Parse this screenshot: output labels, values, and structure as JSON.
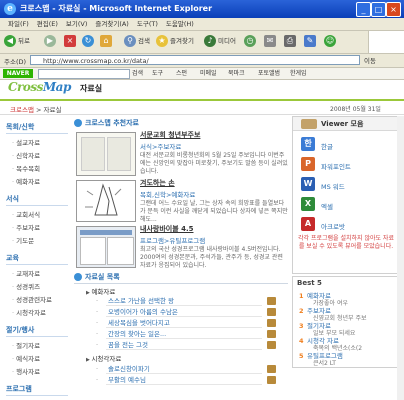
{
  "window": {
    "title": "크로스맵 - 자료실 - Microsoft Internet Explorer",
    "minimize": "_",
    "maximize": "□",
    "close": "×"
  },
  "menu": [
    "파일(F)",
    "편집(E)",
    "보기(V)",
    "즐겨찾기(A)",
    "도구(T)",
    "도움말(H)"
  ],
  "toolbar": {
    "back": "뒤로",
    "search": "검색",
    "favorites": "즐겨찾기",
    "media": "미디어"
  },
  "address": {
    "label": "주소(D)",
    "url": "http://www.crossmap.co.kr/data/",
    "go": "이동"
  },
  "naver": {
    "brand": "NAVER",
    "items": [
      "검색",
      "도구",
      "스펀",
      "미메일",
      "북마크",
      "포토앨범",
      "한게임"
    ]
  },
  "header": {
    "logo_a": "Cross",
    "logo_b": "Map",
    "section": "자료실"
  },
  "breadcrumb": {
    "home": "크로스맵",
    "sep": " > ",
    "current": "자료실"
  },
  "date": "2008년 05월 31일",
  "leftnav": [
    {
      "head": "목회/신학",
      "items": [
        "설교자료",
        "신학자료",
        "목수목회",
        "예화자료"
      ]
    },
    {
      "head": "서식",
      "items": [
        "교회서식",
        "주보자료",
        "기도문"
      ]
    },
    {
      "head": "교육",
      "items": [
        "교재자료",
        "성경퀴즈",
        "성경관련자료",
        "시청각자료"
      ]
    },
    {
      "head": "절기/행사",
      "items": [
        "절기자료",
        "예식자료",
        "행사자료"
      ]
    },
    {
      "head": "프로그램",
      "items": []
    }
  ],
  "recommended": {
    "title": "크로스맵 추천자료",
    "items": [
      {
        "title": "서문교회 청년부주보",
        "cat": "서식>주보자료",
        "desc": "대전 서문교회 비롱청년회의 5월 25일 주보입니다 이번주에는 신앙인의 맞잡아 미로찾기, 주보기도 말씀 등이 실려있습니다."
      },
      {
        "title": "겨도하는 손",
        "cat": "목회,신학>예화자료",
        "desc": "그랜데 어느 수요일 날, 그는 상자 속의 희망표를 들열보다가 문득 이런 사실을 깨닫게 되었습니다 상자에 넣은 쪽지만 해도..."
      },
      {
        "title": "내사랑바이블 4.5",
        "cat": "프로그램>유틸프로그램",
        "desc": "최고의 국산 성경프로그램 내사랑바이블 4.5버전입니다. 2000여의 성경본문과, 주석가들, 관주가 등, 성경교 관련 자료가 응집되어 있습니다."
      }
    ]
  },
  "list": {
    "title": "자료실 목록",
    "groups": [
      {
        "head": "예화자료",
        "rows": [
          "스스로 가난을 선택한 왕",
          "오병이어가 아름의 수남은",
          "세상목심을 벗어다지고",
          "간장의 찾아는 일은...",
          "꿈을 전는 그것"
        ]
      },
      {
        "head": "시청각자료",
        "rows": [
          "솔로신창이파기",
          "부활의 예수님"
        ]
      }
    ]
  },
  "viewer": {
    "title": "Viewer 모음",
    "items": [
      {
        "label": "한글",
        "icon": "hwp-icon",
        "glyph": "한",
        "color": "#3a7bd5"
      },
      {
        "label": "파워포인트",
        "icon": "powerpoint-icon",
        "glyph": "P",
        "color": "#d9662b"
      },
      {
        "label": "MS 워드",
        "icon": "word-icon",
        "glyph": "W",
        "color": "#2b5fb3"
      },
      {
        "label": "엑셀",
        "icon": "excel-icon",
        "glyph": "X",
        "color": "#2e8b3a"
      },
      {
        "label": "아크로밧",
        "icon": "acrobat-icon",
        "glyph": "A",
        "color": "#c62a2a"
      }
    ],
    "note": "각각 프로그램을 설치하지 않아도 자료를 보실 수 있도록 뷰어를 모았습니다."
  },
  "best": {
    "title": "Best 5",
    "items": [
      {
        "n": "1",
        "title": "예화자료",
        "sub": "가장좋아 여우"
      },
      {
        "n": "2",
        "title": "주보자료",
        "sub": "신영교회 청년부 주보"
      },
      {
        "n": "3",
        "title": "절기자료",
        "sub": "일보 부모 되세요"
      },
      {
        "n": "4",
        "title": "시청각 자료",
        "sub": "축복의 백년소(소(2"
      },
      {
        "n": "5",
        "title": "유틸프로그램",
        "sub": "큰서2 LT"
      }
    ]
  }
}
